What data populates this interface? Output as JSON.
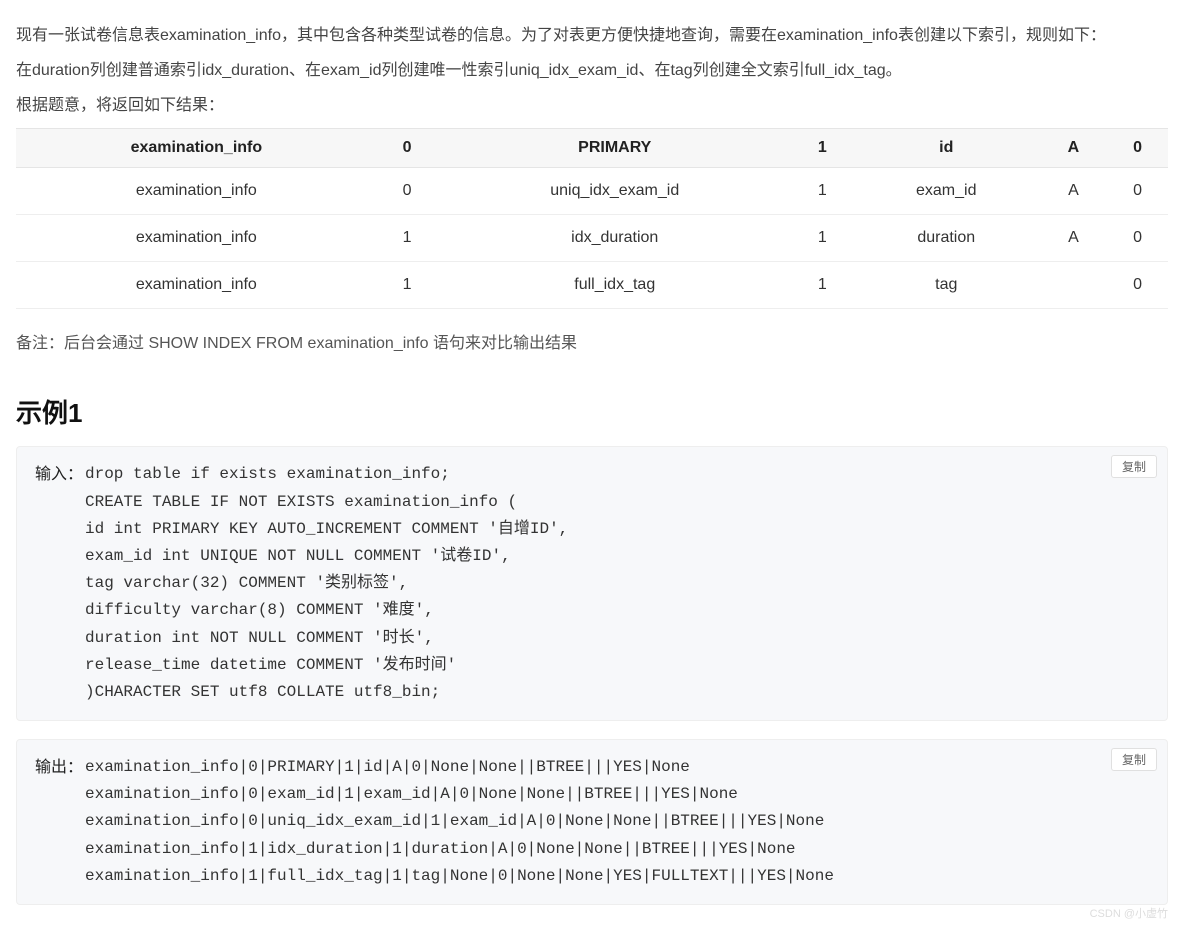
{
  "intro": {
    "p1": "现有一张试卷信息表examination_info，其中包含各种类型试卷的信息。为了对表更方便快捷地查询，需要在examination_info表创建以下索引，规则如下：",
    "p2": "在duration列创建普通索引idx_duration、在exam_id列创建唯一性索引uniq_idx_exam_id、在tag列创建全文索引full_idx_tag。",
    "p3": "根据题意，将返回如下结果："
  },
  "table": {
    "headers": [
      "examination_info",
      "0",
      "PRIMARY",
      "1",
      "id",
      "A",
      "0"
    ],
    "rows": [
      [
        "examination_info",
        "0",
        "uniq_idx_exam_id",
        "1",
        "exam_id",
        "A",
        "0"
      ],
      [
        "examination_info",
        "1",
        "idx_duration",
        "1",
        "duration",
        "A",
        "0"
      ],
      [
        "examination_info",
        "1",
        "full_idx_tag",
        "1",
        "tag",
        "",
        "0"
      ]
    ]
  },
  "note": "备注：后台会通过 SHOW INDEX FROM examination_info 语句来对比输出结果",
  "example_title": "示例1",
  "copy_label": "复制",
  "code1": {
    "label": "输入：",
    "lines": [
      "drop table if exists examination_info;",
      "CREATE TABLE IF NOT EXISTS examination_info (",
      "id int PRIMARY KEY AUTO_INCREMENT COMMENT '自增ID',",
      "exam_id int UNIQUE NOT NULL COMMENT '试卷ID',",
      "tag varchar(32) COMMENT '类别标签',",
      "difficulty varchar(8) COMMENT '难度',",
      "duration int NOT NULL COMMENT '时长',",
      "release_time datetime COMMENT '发布时间'",
      ")CHARACTER SET utf8 COLLATE utf8_bin;"
    ]
  },
  "code2": {
    "label": "输出：",
    "lines": [
      "examination_info|0|PRIMARY|1|id|A|0|None|None||BTREE|||YES|None",
      "examination_info|0|exam_id|1|exam_id|A|0|None|None||BTREE|||YES|None",
      "examination_info|0|uniq_idx_exam_id|1|exam_id|A|0|None|None||BTREE|||YES|None",
      "examination_info|1|idx_duration|1|duration|A|0|None|None||BTREE|||YES|None",
      "examination_info|1|full_idx_tag|1|tag|None|0|None|None|YES|FULLTEXT|||YES|None"
    ]
  },
  "watermark": "CSDN @小虚竹"
}
